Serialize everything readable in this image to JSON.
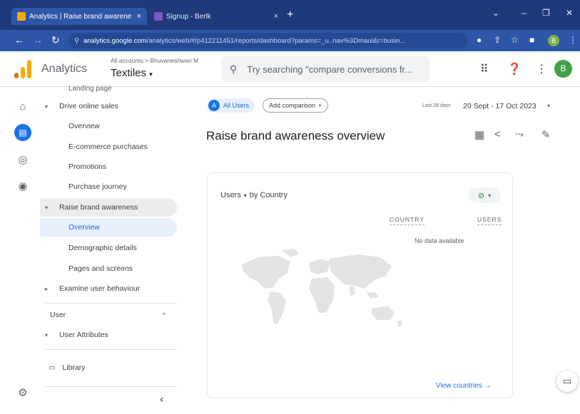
{
  "browser": {
    "tabs": [
      {
        "title": "Analytics | Raise brand awarene",
        "active": true
      },
      {
        "title": "Signup - Berlk",
        "active": false
      }
    ],
    "url_host": "analytics.google.com",
    "url_path": "/analytics/web/#/p412211451/reports/dashboard?params=_u..nav%3Dmaui&r=busin...",
    "profile_letter": "B"
  },
  "header": {
    "app_name": "Analytics",
    "account_crumb": "All accounts > Bhuvaneshwari M",
    "property": "Textiles",
    "search_placeholder": "Try searching \"compare conversions fr...",
    "avatar_letter": "B"
  },
  "nav": {
    "clipped_item": "Landing page",
    "items": [
      {
        "label": "Drive online sales",
        "level": 1,
        "caret": "▾"
      },
      {
        "label": "Overview",
        "level": 2
      },
      {
        "label": "E-commerce purchases",
        "level": 2
      },
      {
        "label": "Promotions",
        "level": 2
      },
      {
        "label": "Purchase journey",
        "level": 2
      },
      {
        "label": "Raise brand awareness",
        "level": 1,
        "caret": "▾"
      },
      {
        "label": "Overview",
        "level": 2
      },
      {
        "label": "Demographic details",
        "level": 2
      },
      {
        "label": "Pages and screens",
        "level": 2
      },
      {
        "label": "Examine user behaviour",
        "level": 1,
        "caret": "▸"
      }
    ],
    "section_user": "User",
    "user_attributes": "User Attributes",
    "library": "Library",
    "collapse_icon": "‹"
  },
  "main": {
    "segment_letter": "A",
    "segment_label": "All Users",
    "comparison_label": "Add comparison",
    "date_small": "Last 28 days",
    "date_range": "20 Sept - 17 Oct 2023",
    "title": "Raise brand awareness overview",
    "card": {
      "metric_label": "Users",
      "dimension_label": "by Country",
      "col_country": "COUNTRY",
      "col_users": "USERS",
      "no_data": "No data available",
      "view_link": "View countries"
    }
  },
  "colors": {
    "accent": "#1a73e8",
    "tabstrip": "#1e3a7a",
    "toolbar": "#2e56a8",
    "nav_selected_bg": "#e8f0fe"
  },
  "icons": [
    "home-icon",
    "reports-icon",
    "explore-icon",
    "advertising-icon",
    "settings-icon",
    "apps-icon",
    "help-icon",
    "more-icon",
    "share-icon",
    "insights-icon",
    "edit-icon",
    "customize-icon",
    "feedback-icon"
  ]
}
